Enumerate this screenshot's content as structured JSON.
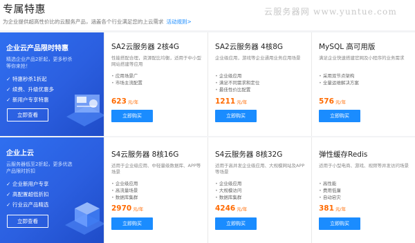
{
  "header": {
    "title": "专属特惠",
    "subtitle": "为企业提供超高性价比的云服务产品，涵盖各个行业满足您的上云需求",
    "rules_link": "活动规则>",
    "watermark": "云服务器网 www.yuntue.com"
  },
  "rows": [
    {
      "promo": {
        "title": "企业云产品限时特惠",
        "desc": "精选企业产品2折起，更多秒杀等你来抢！",
        "features": [
          "特惠秒杀1折起",
          "续费、升级优惠多",
          "新用户专享特惠"
        ],
        "button": "立即查看"
      },
      "cards": [
        {
          "title": "SA2云服务器 2核4G",
          "desc": "性能搭配合理，资源配比均衡，适用于中小型网站搭建等应用",
          "features": [
            "应用场景广",
            "市场主流配置"
          ],
          "price": "623",
          "unit": "元/年",
          "button": "立即购买"
        },
        {
          "title": "SA2云服务器 4核8G",
          "desc": "企业级应用，游戏等企业通用业务应用场景",
          "features": [
            "企业级应用",
            "满足不同需求和定位",
            "最佳性价比配置"
          ],
          "price": "1211",
          "unit": "元/年",
          "button": "立即购买"
        },
        {
          "title": "MySQL 高可用版",
          "desc": "满足企业快速搭建官网及小程序的业务需求",
          "features": [
            "采用双节点架构",
            "全量运维解决方案"
          ],
          "price": "576",
          "unit": "元/年",
          "button": "立即购买"
        }
      ]
    },
    {
      "promo": {
        "title": "企业上云",
        "desc": "云服务器低至2折起，更多优选产品限时折扣",
        "features": [
          "企业新用户专享",
          "高配置超低折扣",
          "行业云产品精选"
        ],
        "button": "立即查看"
      },
      "cards": [
        {
          "title": "S4云服务器 8核16G",
          "desc": "适用于企业级应用、中轻量级数据库、APP等场景",
          "features": [
            "企业级应用",
            "高流量场景",
            "数据库集群"
          ],
          "price": "2970",
          "unit": "元/年",
          "button": "立即购买"
        },
        {
          "title": "S4云服务器 8核32G",
          "desc": "适用于高并发企业级应用、大规模网站及APP等场景",
          "features": [
            "企业级应用",
            "大规模访问",
            "数据库集群"
          ],
          "price": "4246",
          "unit": "元/年",
          "button": "立即购买"
        },
        {
          "title": "弹性缓存Redis",
          "desc": "适用于小型电商、游戏、视频等并发访问场景",
          "features": [
            "高性能",
            "费用低廉",
            "自动宕灾"
          ],
          "price": "381",
          "unit": "元/年",
          "button": "立即购买"
        }
      ]
    }
  ]
}
